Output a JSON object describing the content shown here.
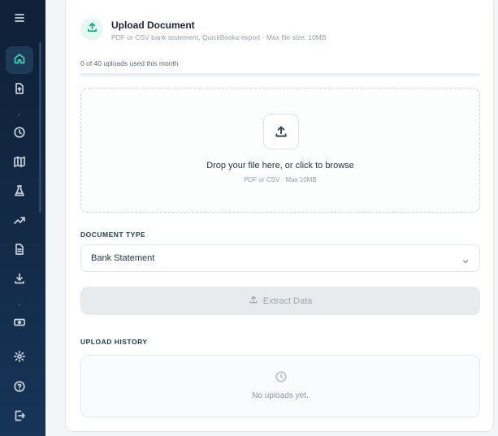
{
  "upload": {
    "title": "Upload Document",
    "subtitle": "PDF or CSV bank statement, QuickBooks export · Max file size: 10MB",
    "usage_text": "0 of 40 uploads used this month",
    "usage_fraction": 0,
    "dropzone": {
      "main_text": "Drop your file here, or click to browse",
      "sub_text": "PDF or CSV · Max 10MB"
    },
    "document_type_label": "DOCUMENT TYPE",
    "document_type_value": "Bank Statement",
    "extract_label": "Extract Data",
    "history_label": "UPLOAD HISTORY",
    "history_empty_text": "No uploads yet."
  },
  "sidebar": {
    "items": [
      {
        "icon": "menu-icon"
      },
      {
        "icon": "home-icon",
        "active": true
      },
      {
        "icon": "file-upload-icon"
      },
      {
        "icon": "clock-icon"
      },
      {
        "icon": "map-icon"
      },
      {
        "icon": "flask-icon"
      },
      {
        "icon": "trending-up-icon"
      },
      {
        "icon": "document-icon"
      },
      {
        "icon": "download-icon"
      },
      {
        "icon": "money-icon"
      },
      {
        "icon": "settings-icon"
      },
      {
        "icon": "help-icon"
      },
      {
        "icon": "logout-icon"
      }
    ]
  },
  "colors": {
    "accent": "#14a383",
    "sidebar_bg": "#0f2037",
    "active_icon": "#3fd4b3"
  }
}
